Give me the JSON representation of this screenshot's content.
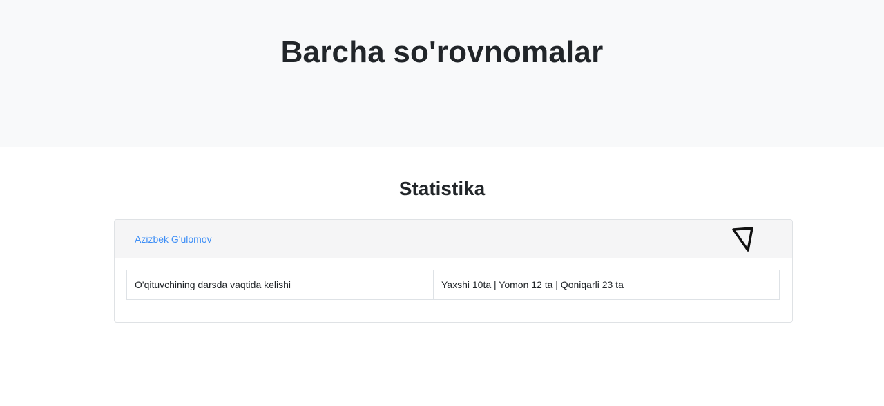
{
  "page": {
    "title": "Barcha so'rovnomalar"
  },
  "statistics": {
    "heading": "Statistika",
    "cards": [
      {
        "teacher": "Azizbek G'ulomov",
        "toggle_icon": "triangle-down-icon",
        "rows": [
          {
            "question": "O'qituvchining darsda vaqtida kelishi",
            "result": "Yaxshi 10ta | Yomon 12 ta | Qoniqarli 23 ta"
          }
        ]
      }
    ]
  },
  "colors": {
    "hero_background": "#f8f9fa",
    "link": "#3f8ff6",
    "text": "#212529",
    "card_header": "#f5f5f6",
    "border": "#dee2e6"
  }
}
